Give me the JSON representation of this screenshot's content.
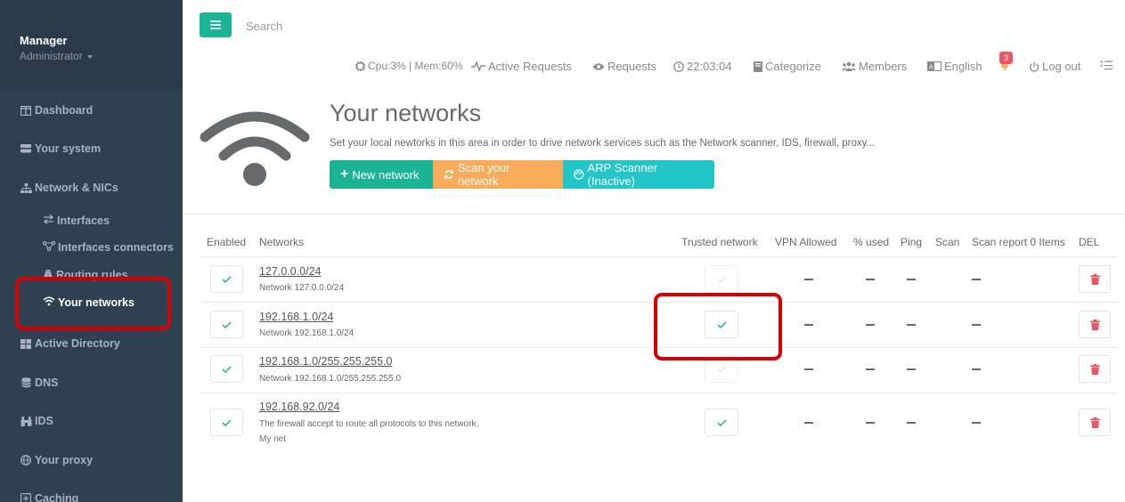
{
  "sidebar": {
    "profile": {
      "name": "Manager",
      "role": "Administrator"
    },
    "items": [
      {
        "label": "Dashboard",
        "icon": "columns-icon"
      },
      {
        "label": "Your system",
        "icon": "hdd-icon"
      },
      {
        "label": "Network & NICs",
        "icon": "sitemap-icon"
      },
      {
        "label": "Active Directory",
        "icon": "windows-icon"
      },
      {
        "label": "DNS",
        "icon": "database-icon"
      },
      {
        "label": "IDS",
        "icon": "binoculars-icon"
      },
      {
        "label": "Your proxy",
        "icon": "globe-icon"
      },
      {
        "label": "Caching",
        "icon": "caching-icon"
      }
    ],
    "subitems": [
      {
        "label": "Interfaces",
        "icon": "exchange-icon"
      },
      {
        "label": "Interfaces connectors",
        "icon": "connectors-icon"
      },
      {
        "label": "Routing rules",
        "icon": "routing-icon"
      },
      {
        "label": "Your networks",
        "icon": "wifi-icon"
      }
    ]
  },
  "topbar": {
    "search_placeholder": "Search",
    "cpu_mem": "Cpu:3% | Mem:60%",
    "active_requests": "Active Requests",
    "requests": "Requests",
    "time": "22:03:04",
    "categorize": "Categorize",
    "members": "Members",
    "language": "English",
    "notifications_count": "3",
    "logout": "Log out"
  },
  "header": {
    "title": "Your networks",
    "description": "Set your local newtorks in this area in order to drive network services such as the Network scanner, IDS, firewall, proxy...",
    "new_network": "New network",
    "scan_network": "Scan your network",
    "arp_scanner": "ARP Scanner (Inactive)"
  },
  "table": {
    "headers": {
      "enabled": "Enabled",
      "networks": "Networks",
      "trusted": "Trusted network",
      "vpn": "VPN Allowed",
      "used": "% used",
      "ping": "Ping",
      "scan": "Scan",
      "scan_report": "Scan report 0 Items",
      "del": "DEL"
    },
    "rows": [
      {
        "network": "127.0.0.0/24",
        "desc": "Network 127.0.0.0/24",
        "desc2": "",
        "enabled": true,
        "trusted": false
      },
      {
        "network": "192.168.1.0/24",
        "desc": "Network 192.168.1.0/24",
        "desc2": "",
        "enabled": true,
        "trusted": true
      },
      {
        "network": "192.168.1.0/255.255.255.0",
        "desc": "Network 192.168.1.0/255.255.255.0",
        "desc2": "",
        "enabled": true,
        "trusted": false
      },
      {
        "network": "192.168.92.0/24",
        "desc": "The firewall accept to route all protocols to this network,",
        "desc2": "My net",
        "enabled": true,
        "trusted": true
      }
    ]
  },
  "colors": {
    "sidebar_bg": "#2f4050",
    "primary": "#1ab394",
    "warning": "#f8ac59",
    "info": "#23c6c8",
    "danger": "#ed5565",
    "highlight": "#d70000"
  }
}
